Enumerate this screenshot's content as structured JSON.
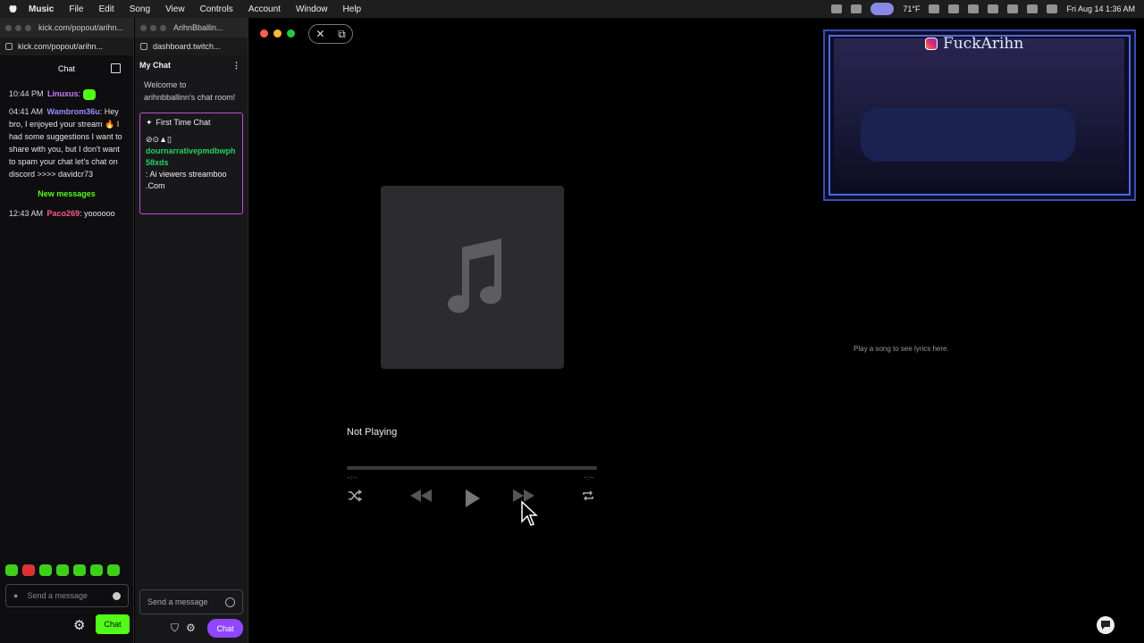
{
  "menubar": {
    "app": "Music",
    "items": [
      "File",
      "Edit",
      "Song",
      "View",
      "Controls",
      "Account",
      "Window",
      "Help"
    ],
    "weather": "71°F",
    "datetime": "Fri Aug 14  1:36 AM"
  },
  "kick": {
    "url": "kick.com/popout/arihn...",
    "header": "Chat",
    "messages": [
      {
        "time": "10:44 PM",
        "user": "Linuxus",
        "text": ""
      },
      {
        "time": "04:41 AM",
        "user": "Wambrom36u",
        "text": "Hey bro, I enjoyed your stream 🔥 I had some suggestions I want to share with you, but I don't want to spam your chat let's chat on discord >>>> davidcr73"
      },
      {
        "time": "12:43 AM",
        "user": "Paco269",
        "text": "yoooooo"
      }
    ],
    "new_messages": "New messages",
    "input_placeholder": "Send a message",
    "send_label": "Chat"
  },
  "twitch": {
    "window_title": "ArihnBballin...",
    "url": "dashboard.twitch...",
    "panel_title": "My Chat",
    "welcome": "Welcome to arihnbballinn's chat room!",
    "first_time_label": "First Time Chat",
    "ftc_user": "dournarrativepmdbwph58xds",
    "ftc_text": ": Ai viewers streamboo .Com",
    "input_placeholder": "Send a message",
    "chat_button": "Chat"
  },
  "music": {
    "status": "Not Playing",
    "time_left": "--:--",
    "time_right": "--:--",
    "lyrics_hint": "Play a song to see lyrics here.",
    "colors": {
      "accent_green": "#53fc18",
      "twitch_purple": "#9147ff"
    }
  },
  "overlay": {
    "handle": "FuckArihn"
  }
}
